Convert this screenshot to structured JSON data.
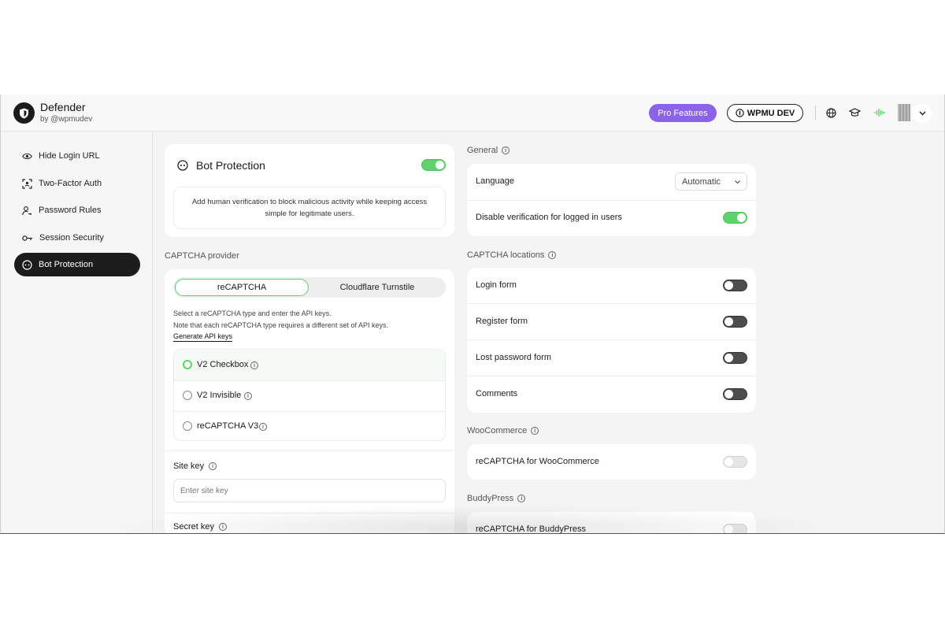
{
  "brand": {
    "title": "Defender",
    "by": "by",
    "author": "wpmudev"
  },
  "header": {
    "pro_label": "Pro Features",
    "wpmu_label": "WPMU DEV"
  },
  "sidebar": {
    "items": [
      {
        "label": "Hide Login URL",
        "icon": "eye-icon"
      },
      {
        "label": "Two-Factor Auth",
        "icon": "face-scan-icon"
      },
      {
        "label": "Password Rules",
        "icon": "user-key-icon"
      },
      {
        "label": "Session Security",
        "icon": "key-icon"
      },
      {
        "label": "Bot Protection",
        "icon": "bot-face-icon"
      }
    ],
    "active": "Bot Protection"
  },
  "bot_protection": {
    "title": "Bot Protection",
    "enabled": true,
    "description_line1": "Add human verification to block malicious activity while keeping access",
    "description_line2": "simple for legitimate users."
  },
  "captcha_provider": {
    "label": "CAPTCHA provider",
    "tabs": [
      "reCAPTCHA",
      "Cloudflare Turnstile"
    ],
    "active_tab": "reCAPTCHA",
    "help_line1": "Select a reCAPTCHA type and enter the API keys.",
    "help_line2": "Note that each reCAPTCHA type requires a different set of API keys.",
    "generate_link": "Generate API keys",
    "types": [
      {
        "label": "V2 Checkbox",
        "checked": true
      },
      {
        "label": "V2 Invisible",
        "checked": false
      },
      {
        "label": "reCAPTCHA V3",
        "checked": false
      }
    ],
    "site_key_label": "Site key",
    "site_key_placeholder": "Enter site key",
    "secret_key_label": "Secret key"
  },
  "general": {
    "label": "General",
    "language_label": "Language",
    "language_value": "Automatic",
    "disable_logged_in_label": "Disable verification for logged in users",
    "disable_logged_in": true
  },
  "captcha_locations": {
    "label": "CAPTCHA locations",
    "items": [
      {
        "label": "Login form",
        "enabled": false
      },
      {
        "label": "Register form",
        "enabled": false
      },
      {
        "label": "Lost password form",
        "enabled": false
      },
      {
        "label": "Comments",
        "enabled": false
      }
    ]
  },
  "woocommerce": {
    "label": "WooCommerce",
    "item_label": "reCAPTCHA for WooCommerce",
    "enabled": false,
    "disabled": true
  },
  "buddypress": {
    "label": "BuddyPress",
    "item_label": "reCAPTCHA for BuddyPress",
    "enabled": false,
    "disabled": true
  },
  "colors": {
    "accent_green": "#5fd36b",
    "pro_purple": "#8b63e6",
    "dark": "#1c1c1c"
  }
}
